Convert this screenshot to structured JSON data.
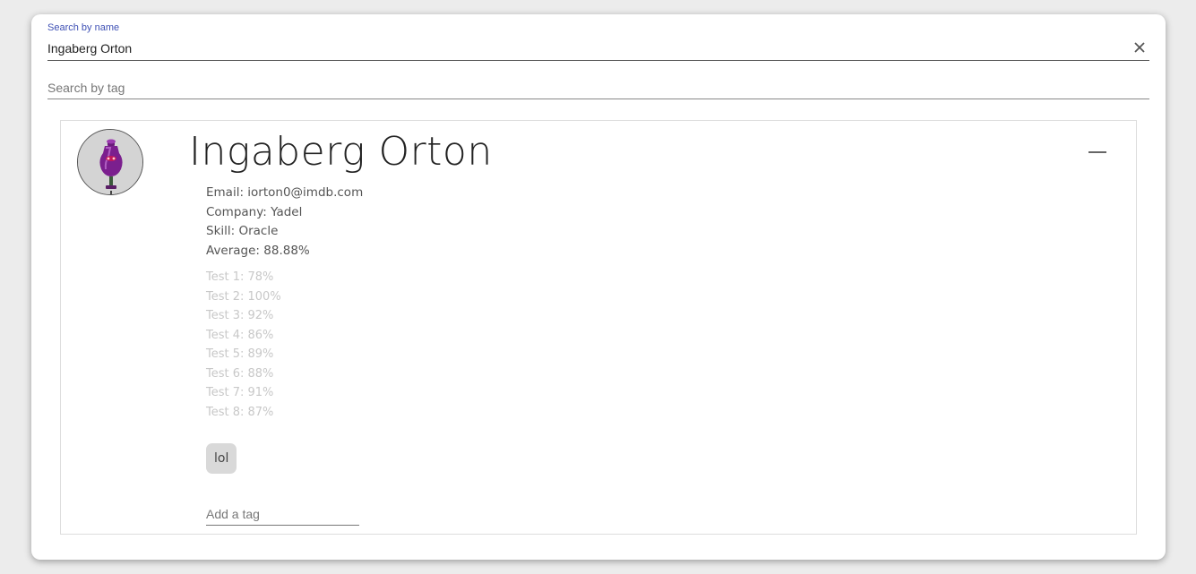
{
  "search": {
    "name_label": "Search by name",
    "name_value": "Ingaberg Orton",
    "tag_placeholder": "Search by tag"
  },
  "student": {
    "name": "Ingaberg Orton",
    "email_line": "Email: iorton0@imdb.com",
    "company_line": "Company: Yadel",
    "skill_line": "Skill: Oracle",
    "average_line": "Average: 88.88%",
    "tests": [
      "Test 1: 78%",
      "Test 2: 100%",
      "Test 3: 92%",
      "Test 4: 86%",
      "Test 5: 89%",
      "Test 6: 88%",
      "Test 7: 91%",
      "Test 8: 87%"
    ],
    "tags": [
      "lol"
    ],
    "add_tag_placeholder": "Add a tag"
  },
  "icons": {
    "clear": "close-icon",
    "collapse": "minus-icon",
    "avatar": "avatar-image"
  },
  "colors": {
    "label_accent": "#3f51b5",
    "card_border": "#dddddd",
    "tag_chip_bg": "#d9d9d9"
  }
}
